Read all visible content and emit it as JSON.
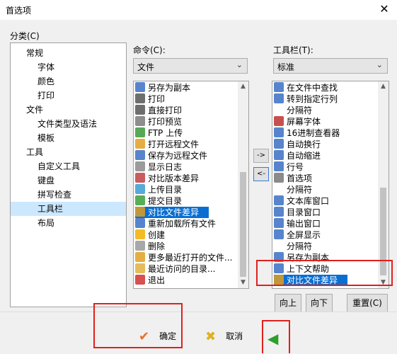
{
  "window": {
    "title": "首选项",
    "close_glyph": "✕"
  },
  "category": {
    "label": "分类(C)",
    "items": [
      {
        "label": "常规",
        "level": 0,
        "selected": false
      },
      {
        "label": "字体",
        "level": 1,
        "selected": false
      },
      {
        "label": "颜色",
        "level": 1,
        "selected": false
      },
      {
        "label": "打印",
        "level": 1,
        "selected": false
      },
      {
        "label": "文件",
        "level": 0,
        "selected": false
      },
      {
        "label": "文件类型及语法",
        "level": 1,
        "selected": false
      },
      {
        "label": "模板",
        "level": 1,
        "selected": false
      },
      {
        "label": "工具",
        "level": 0,
        "selected": false
      },
      {
        "label": "自定义工具",
        "level": 1,
        "selected": false
      },
      {
        "label": "键盘",
        "level": 1,
        "selected": false
      },
      {
        "label": "拼写检查",
        "level": 1,
        "selected": false
      },
      {
        "label": "工具栏",
        "level": 1,
        "selected": true
      },
      {
        "label": "布局",
        "level": 1,
        "selected": false
      }
    ]
  },
  "commands": {
    "label": "命令(C):",
    "dropdown_value": "文件",
    "items": [
      {
        "text": "另存为副本",
        "icon": "save-copy-icon",
        "color": "#3a6fc4"
      },
      {
        "text": "打印",
        "icon": "print-icon",
        "color": "#555555"
      },
      {
        "text": "直接打印",
        "icon": "print-direct-icon",
        "color": "#555555"
      },
      {
        "text": "打印预览",
        "icon": "print-preview-icon",
        "color": "#7a7a7a"
      },
      {
        "text": "FTP 上传",
        "icon": "ftp-upload-icon",
        "color": "#3a9a3a"
      },
      {
        "text": "打开远程文件",
        "icon": "open-remote-icon",
        "color": "#e0a020"
      },
      {
        "text": "保存为远程文件",
        "icon": "save-remote-icon",
        "color": "#3a6fc4"
      },
      {
        "text": "显示日志",
        "icon": "log-icon",
        "color": "#8a8a8a"
      },
      {
        "text": "对比版本差异",
        "icon": "compare-version-icon",
        "color": "#c04040"
      },
      {
        "text": "上传目录",
        "icon": "upload-dir-icon",
        "color": "#3a9ad4"
      },
      {
        "text": "提交目录",
        "icon": "commit-dir-icon",
        "color": "#3aa03a"
      },
      {
        "text": "对比文件差异",
        "icon": "compare-file-icon",
        "color": "#e0a020"
      },
      {
        "text": "重新加载所有文件",
        "icon": "reload-icon",
        "color": "#3a6fc4"
      },
      {
        "text": "创建",
        "icon": "create-icon",
        "color": "#f0b000"
      },
      {
        "text": "删除",
        "icon": "delete-icon",
        "color": "#999999"
      },
      {
        "text": "更多最近打开的文件...",
        "icon": "recent-files-icon",
        "color": "#e0a020"
      },
      {
        "text": "最近访问的目录...",
        "icon": "recent-dirs-icon",
        "color": "#e0b040"
      },
      {
        "text": "退出",
        "icon": "exit-icon",
        "color": "#d03030"
      }
    ],
    "selected_index": 11
  },
  "toolbar": {
    "label": "工具栏(T):",
    "dropdown_value": "标准",
    "items": [
      {
        "text": "在文件中查找",
        "icon": "find-in-files-icon",
        "color": "#3a6fc4"
      },
      {
        "text": "转到指定行列",
        "icon": "goto-line-icon",
        "color": "#3a6fc4"
      },
      {
        "text": "分隔符",
        "icon": "",
        "color": ""
      },
      {
        "text": "屏幕字体",
        "icon": "screen-font-icon",
        "color": "#c03030"
      },
      {
        "text": "16进制查看器",
        "icon": "hex-viewer-icon",
        "color": "#3a6fc4"
      },
      {
        "text": "自动换行",
        "icon": "word-wrap-icon",
        "color": "#3a6fc4"
      },
      {
        "text": "自动缩进",
        "icon": "auto-indent-icon",
        "color": "#3a6fc4"
      },
      {
        "text": "行号",
        "icon": "line-number-icon",
        "color": "#3a6fc4"
      },
      {
        "text": "首选项",
        "icon": "preferences-icon",
        "color": "#777777"
      },
      {
        "text": "分隔符",
        "icon": "",
        "color": ""
      },
      {
        "text": "文本库窗口",
        "icon": "text-library-icon",
        "color": "#3a6fc4"
      },
      {
        "text": "目录窗口",
        "icon": "directory-window-icon",
        "color": "#3a6fc4"
      },
      {
        "text": "输出窗口",
        "icon": "output-window-icon",
        "color": "#3a6fc4"
      },
      {
        "text": "全屏显示",
        "icon": "fullscreen-icon",
        "color": "#3a6fc4"
      },
      {
        "text": "分隔符",
        "icon": "",
        "color": ""
      },
      {
        "text": "另存为副本",
        "icon": "save-copy-icon",
        "color": "#3a6fc4"
      },
      {
        "text": "上下文帮助",
        "icon": "context-help-icon",
        "color": "#3a6fc4"
      },
      {
        "text": "对比文件差异",
        "icon": "compare-file-icon",
        "color": "#e0a020"
      }
    ],
    "selected_index": 17
  },
  "transfer": {
    "add": "->",
    "remove": "<-"
  },
  "buttons": {
    "up": "向上",
    "down": "向下",
    "reset": "重置(C)"
  },
  "footer": {
    "ok": "确定",
    "cancel": "取消"
  },
  "colors": {
    "selection": "#0a6ed1",
    "highlight_box": "#e0201c",
    "tree_selected": "#cce8ff"
  }
}
